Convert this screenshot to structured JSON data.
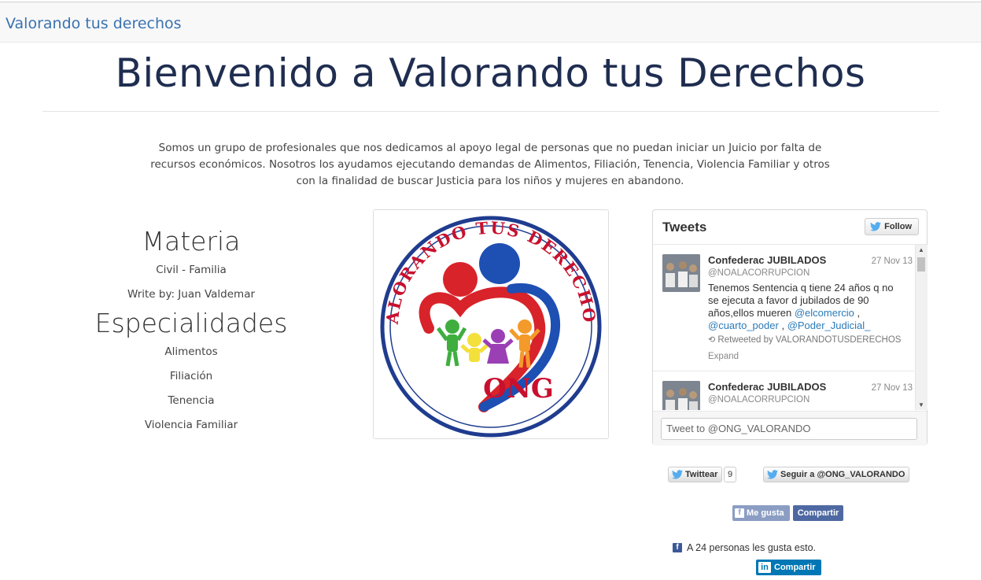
{
  "navbar": {
    "brand": "Valorando tus derechos"
  },
  "hero": {
    "title": "Bienvenido a Valorando tus Derechos",
    "intro": "Somos un grupo de profesionales que nos dedicamos al apoyo legal de personas que no puedan iniciar un Juicio por falta de recursos económicos. Nosotros los ayudamos ejecutando demandas de Alimentos, Filiación, Tenencia, Violencia Familiar y otros con la finalidad de buscar Justicia para los niños y mujeres en abandono."
  },
  "left": {
    "materia_heading": "Materia",
    "materia_value": "Civil - Familia",
    "author": "Write by: Juan Valdemar",
    "especialidades_heading": "Especialidades",
    "especialidades": [
      "Alimentos",
      "Filiación",
      "Tenencia",
      "Violencia Familiar"
    ]
  },
  "logo": {
    "ring_text": "VALORANDO TUS DERECHOS",
    "center_text": "ONG",
    "colors": {
      "ring": "#1f3c8f",
      "text": "#c8102e",
      "heart_red": "#d8232a",
      "heart_blue": "#1e4fb3"
    }
  },
  "twitter": {
    "title": "Tweets",
    "follow_label": "Follow",
    "tweets": [
      {
        "name": "Confederac JUBILADOS",
        "date": "27 Nov 13",
        "handle": "@NOALACORRUPCION",
        "text": "Tenemos Sentencia q tiene 24 años q no se ejecuta a favor d jubilados de 90 años,ellos mueren",
        "mentions": [
          "@elcomercio",
          "@cuarto_poder",
          "@Poder_Judicial_"
        ],
        "retweeted_by": "Retweeted by VALORANDOTUSDERECHOS",
        "expand": "Expand"
      },
      {
        "name": "Confederac JUBILADOS",
        "date": "27 Nov 13",
        "handle": "@NOALACORRUPCION"
      }
    ],
    "compose_placeholder": "Tweet to @ONG_VALORANDO"
  },
  "social": {
    "tweet_button": "Twittear",
    "tweet_count": "9",
    "follow_button": "Seguir a @ONG_VALORANDO",
    "fb_like": "Me gusta",
    "fb_share": "Compartir",
    "fb_count_text": "A 24 personas les gusta esto.",
    "linkedin_share": "Compartir"
  }
}
